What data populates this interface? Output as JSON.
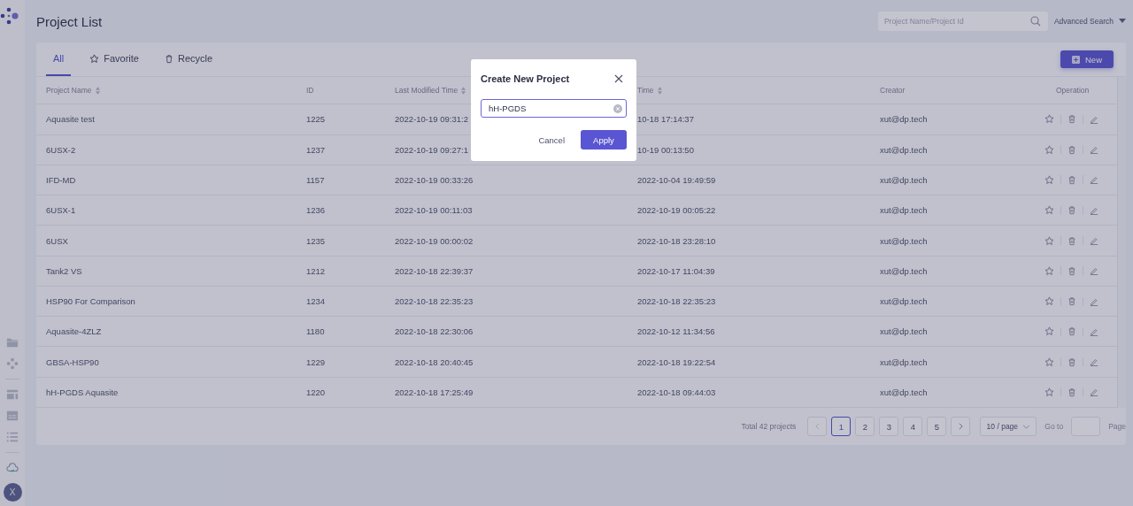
{
  "sidebar": {
    "avatar": "X"
  },
  "header": {
    "title": "Project List",
    "search": {
      "placeholder": "Project Name/Project Id"
    },
    "advanced_search": "Advanced Search"
  },
  "tabs": [
    {
      "label": "All",
      "selected": true,
      "kind": "plain"
    },
    {
      "label": "Favorite",
      "selected": false,
      "kind": "star"
    },
    {
      "label": "Recycle",
      "selected": false,
      "kind": "trash"
    }
  ],
  "new_button": "New",
  "table": {
    "columns": [
      {
        "label": "Project Name",
        "sortable": true
      },
      {
        "label": "ID",
        "sortable": false
      },
      {
        "label": "Last Modified Time",
        "sortable": true
      },
      {
        "label": "Time",
        "sortable": true
      },
      {
        "label": "Creator",
        "sortable": false
      },
      {
        "label": "Operation",
        "sortable": false
      }
    ],
    "rows": [
      {
        "name": "Aquasite test",
        "id": "1225",
        "modified": "2022-10-19 09:31:2",
        "created": "10-18 17:14:37",
        "creator": "xut@dp.tech"
      },
      {
        "name": "6USX-2",
        "id": "1237",
        "modified": "2022-10-19 09:27:1",
        "created": "10-19 00:13:50",
        "creator": "xut@dp.tech"
      },
      {
        "name": "IFD-MD",
        "id": "1157",
        "modified": "2022-10-19 00:33:26",
        "created": "2022-10-04 19:49:59",
        "creator": "xut@dp.tech"
      },
      {
        "name": "6USX-1",
        "id": "1236",
        "modified": "2022-10-19 00:11:03",
        "created": "2022-10-19 00:05:22",
        "creator": "xut@dp.tech"
      },
      {
        "name": "6USX",
        "id": "1235",
        "modified": "2022-10-19 00:00:02",
        "created": "2022-10-18 23:28:10",
        "creator": "xut@dp.tech"
      },
      {
        "name": "Tank2 VS",
        "id": "1212",
        "modified": "2022-10-18 22:39:37",
        "created": "2022-10-17 11:04:39",
        "creator": "xut@dp.tech"
      },
      {
        "name": "HSP90 For Comparison",
        "id": "1234",
        "modified": "2022-10-18 22:35:23",
        "created": "2022-10-18 22:35:23",
        "creator": "xut@dp.tech"
      },
      {
        "name": "Aquasite-4ZLZ",
        "id": "1180",
        "modified": "2022-10-18 22:30:06",
        "created": "2022-10-12 11:34:56",
        "creator": "xut@dp.tech"
      },
      {
        "name": "GBSA-HSP90",
        "id": "1229",
        "modified": "2022-10-18 20:40:45",
        "created": "2022-10-18 19:22:54",
        "creator": "xut@dp.tech"
      },
      {
        "name": "hH-PGDS Aquasite",
        "id": "1220",
        "modified": "2022-10-18 17:25:49",
        "created": "2022-10-18 09:44:03",
        "creator": "xut@dp.tech"
      }
    ]
  },
  "pagination": {
    "total": "Total 42 projects",
    "pages": [
      {
        "label": "1",
        "selected": true
      },
      {
        "label": "2",
        "selected": false
      },
      {
        "label": "3",
        "selected": false
      },
      {
        "label": "4",
        "selected": false
      },
      {
        "label": "5",
        "selected": false
      }
    ],
    "page_size": "10 / page",
    "goto": "Go to",
    "page_suffix": "Page"
  },
  "dialog": {
    "title": "Create New Project",
    "input_value": "hH-PGDS",
    "cancel": "Cancel",
    "apply": "Apply"
  }
}
